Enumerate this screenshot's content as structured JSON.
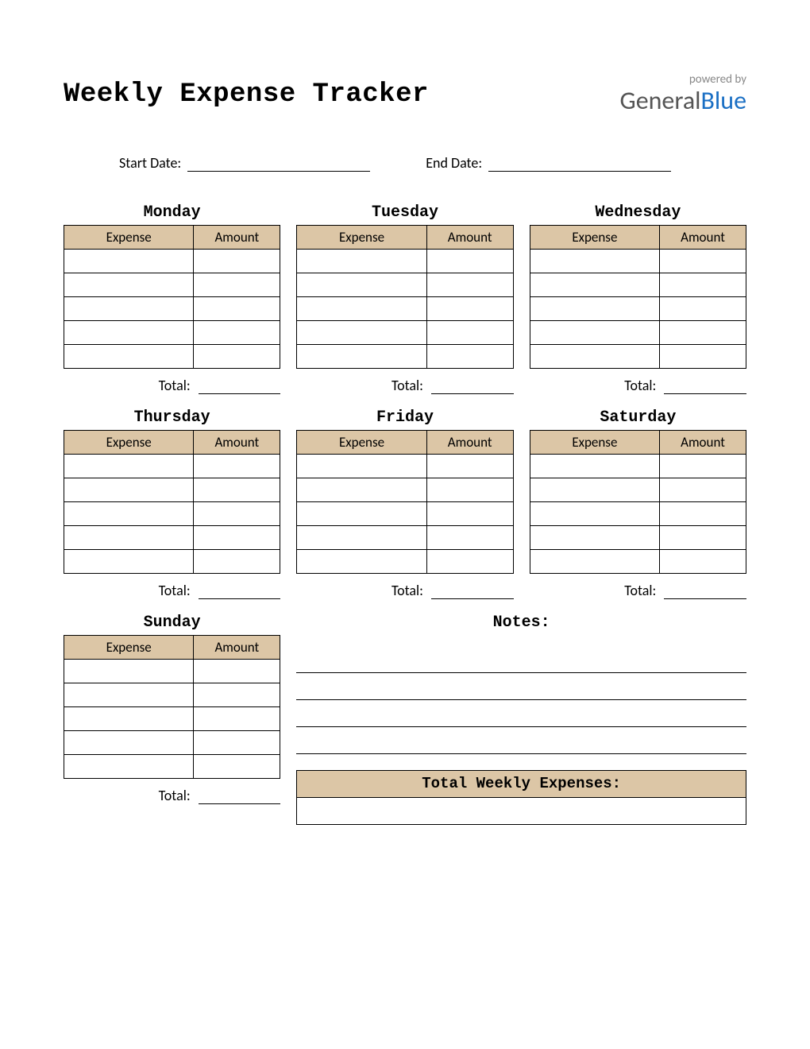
{
  "title": "Weekly Expense Tracker",
  "brand": {
    "powered": "powered by",
    "name_a": "General",
    "name_b": "Blue"
  },
  "dates": {
    "start_label": "Start Date:",
    "start_value": "",
    "end_label": "End Date:",
    "end_value": ""
  },
  "columns": {
    "expense": "Expense",
    "amount": "Amount"
  },
  "total_label": "Total:",
  "days": [
    {
      "name": "Monday",
      "rows": [
        [
          "",
          ""
        ],
        [
          "",
          ""
        ],
        [
          "",
          ""
        ],
        [
          "",
          ""
        ],
        [
          "",
          ""
        ]
      ],
      "total": ""
    },
    {
      "name": "Tuesday",
      "rows": [
        [
          "",
          ""
        ],
        [
          "",
          ""
        ],
        [
          "",
          ""
        ],
        [
          "",
          ""
        ],
        [
          "",
          ""
        ]
      ],
      "total": ""
    },
    {
      "name": "Wednesday",
      "rows": [
        [
          "",
          ""
        ],
        [
          "",
          ""
        ],
        [
          "",
          ""
        ],
        [
          "",
          ""
        ],
        [
          "",
          ""
        ]
      ],
      "total": ""
    },
    {
      "name": "Thursday",
      "rows": [
        [
          "",
          ""
        ],
        [
          "",
          ""
        ],
        [
          "",
          ""
        ],
        [
          "",
          ""
        ],
        [
          "",
          ""
        ]
      ],
      "total": ""
    },
    {
      "name": "Friday",
      "rows": [
        [
          "",
          ""
        ],
        [
          "",
          ""
        ],
        [
          "",
          ""
        ],
        [
          "",
          ""
        ],
        [
          "",
          ""
        ]
      ],
      "total": ""
    },
    {
      "name": "Saturday",
      "rows": [
        [
          "",
          ""
        ],
        [
          "",
          ""
        ],
        [
          "",
          ""
        ],
        [
          "",
          ""
        ],
        [
          "",
          ""
        ]
      ],
      "total": ""
    },
    {
      "name": "Sunday",
      "rows": [
        [
          "",
          ""
        ],
        [
          "",
          ""
        ],
        [
          "",
          ""
        ],
        [
          "",
          ""
        ],
        [
          "",
          ""
        ]
      ],
      "total": ""
    }
  ],
  "notes": {
    "title": "Notes:",
    "lines": [
      "",
      "",
      "",
      ""
    ]
  },
  "weekly_total": {
    "label": "Total Weekly Expenses:",
    "value": ""
  }
}
